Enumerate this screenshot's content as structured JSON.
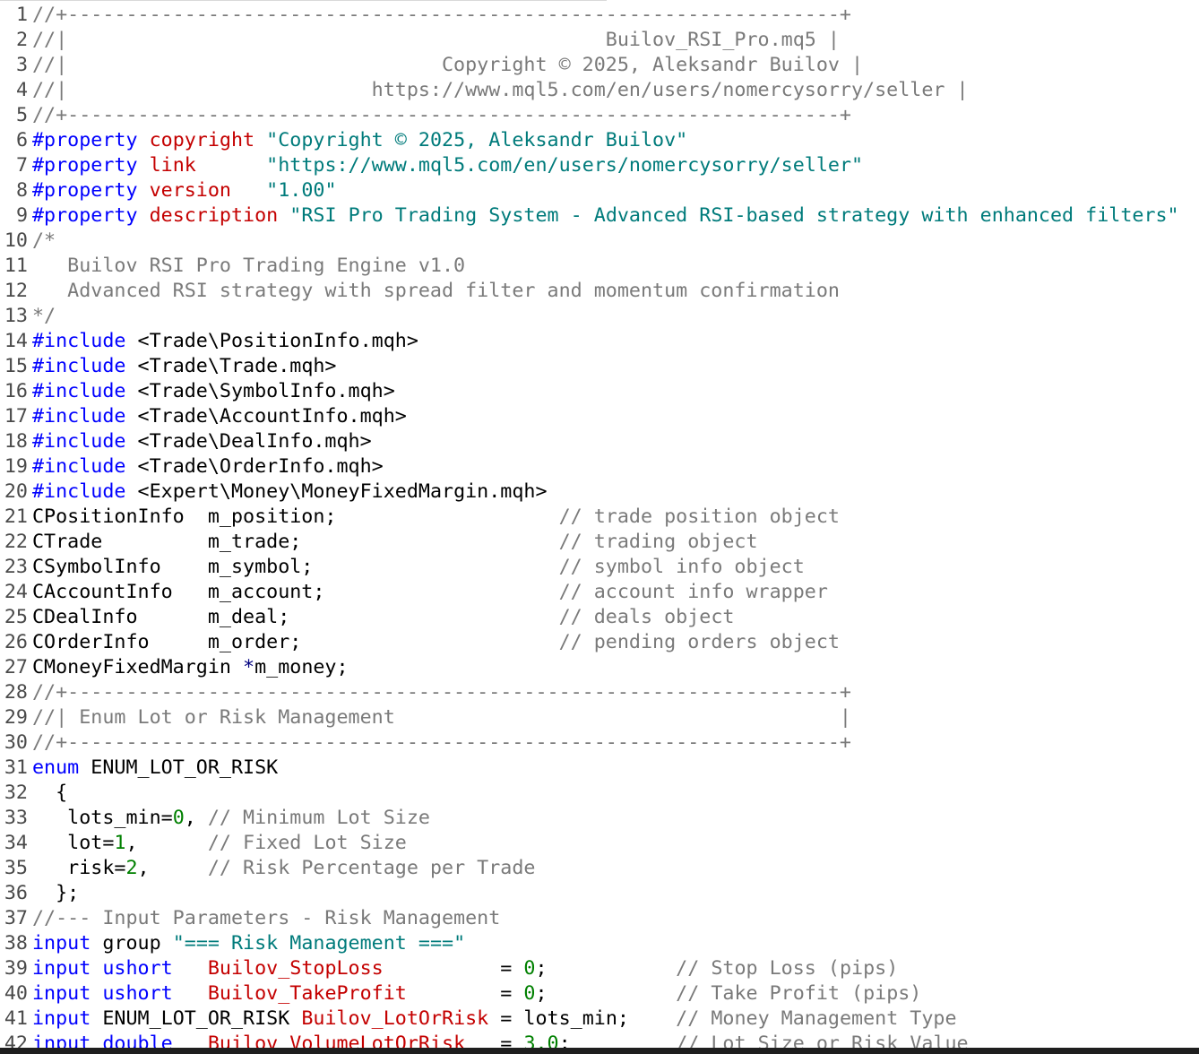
{
  "editor": {
    "file": "Builov_RSI_Pro.mq5",
    "colors": {
      "background": "#ffffff",
      "comment": "#7a7a7a",
      "keyword": "#0000ff",
      "property": "#c40000",
      "string": "#007b7b",
      "number": "#008000",
      "plain": "#000000",
      "line_number": "#4a4a4a"
    },
    "lines": [
      {
        "n": "1",
        "tokens": [
          {
            "t": "cmt",
            "v": "//+------------------------------------------------------------------+"
          }
        ]
      },
      {
        "n": "2",
        "tokens": [
          {
            "t": "cmt",
            "v": "//|                                              Builov_RSI_Pro.mq5 |"
          }
        ]
      },
      {
        "n": "3",
        "tokens": [
          {
            "t": "cmt",
            "v": "//|                                Copyright © 2025, Aleksandr Builov |"
          }
        ]
      },
      {
        "n": "4",
        "tokens": [
          {
            "t": "cmt",
            "v": "//|                          https://www.mql5.com/en/users/nomercysorry/seller |"
          }
        ]
      },
      {
        "n": "5",
        "tokens": [
          {
            "t": "cmt",
            "v": "//+------------------------------------------------------------------+"
          }
        ]
      },
      {
        "n": "6",
        "tokens": [
          {
            "t": "kw",
            "v": "#property"
          },
          {
            "t": "pln",
            "v": " "
          },
          {
            "t": "prop",
            "v": "copyright"
          },
          {
            "t": "pln",
            "v": " "
          },
          {
            "t": "str",
            "v": "\"Copyright © 2025, Aleksandr Builov\""
          }
        ]
      },
      {
        "n": "7",
        "tokens": [
          {
            "t": "kw",
            "v": "#property"
          },
          {
            "t": "pln",
            "v": " "
          },
          {
            "t": "prop",
            "v": "link"
          },
          {
            "t": "pln",
            "v": "      "
          },
          {
            "t": "str",
            "v": "\"https://www.mql5.com/en/users/nomercysorry/seller\""
          }
        ]
      },
      {
        "n": "8",
        "tokens": [
          {
            "t": "kw",
            "v": "#property"
          },
          {
            "t": "pln",
            "v": " "
          },
          {
            "t": "prop",
            "v": "version"
          },
          {
            "t": "pln",
            "v": "   "
          },
          {
            "t": "str",
            "v": "\"1.00\""
          }
        ]
      },
      {
        "n": "9",
        "tokens": [
          {
            "t": "kw",
            "v": "#property"
          },
          {
            "t": "pln",
            "v": " "
          },
          {
            "t": "prop",
            "v": "description"
          },
          {
            "t": "pln",
            "v": " "
          },
          {
            "t": "str",
            "v": "\"RSI Pro Trading System - Advanced RSI-based strategy with enhanced filters\""
          }
        ]
      },
      {
        "n": "10",
        "tokens": [
          {
            "t": "cmt",
            "v": "/*"
          }
        ]
      },
      {
        "n": "11",
        "tokens": [
          {
            "t": "cmt",
            "v": "   Builov RSI Pro Trading Engine v1.0"
          }
        ]
      },
      {
        "n": "12",
        "tokens": [
          {
            "t": "cmt",
            "v": "   Advanced RSI strategy with spread filter and momentum confirmation"
          }
        ]
      },
      {
        "n": "13",
        "tokens": [
          {
            "t": "cmt",
            "v": "*/"
          }
        ]
      },
      {
        "n": "14",
        "tokens": [
          {
            "t": "kw",
            "v": "#include"
          },
          {
            "t": "pln",
            "v": " <Trade\\PositionInfo.mqh>"
          }
        ]
      },
      {
        "n": "15",
        "tokens": [
          {
            "t": "kw",
            "v": "#include"
          },
          {
            "t": "pln",
            "v": " <Trade\\Trade.mqh>"
          }
        ]
      },
      {
        "n": "16",
        "tokens": [
          {
            "t": "kw",
            "v": "#include"
          },
          {
            "t": "pln",
            "v": " <Trade\\SymbolInfo.mqh>"
          }
        ]
      },
      {
        "n": "17",
        "tokens": [
          {
            "t": "kw",
            "v": "#include"
          },
          {
            "t": "pln",
            "v": " <Trade\\AccountInfo.mqh>"
          }
        ]
      },
      {
        "n": "18",
        "tokens": [
          {
            "t": "kw",
            "v": "#include"
          },
          {
            "t": "pln",
            "v": " <Trade\\DealInfo.mqh>"
          }
        ]
      },
      {
        "n": "19",
        "tokens": [
          {
            "t": "kw",
            "v": "#include"
          },
          {
            "t": "pln",
            "v": " <Trade\\OrderInfo.mqh>"
          }
        ]
      },
      {
        "n": "20",
        "tokens": [
          {
            "t": "kw",
            "v": "#include"
          },
          {
            "t": "pln",
            "v": " <Expert\\Money\\MoneyFixedMargin.mqh>"
          }
        ]
      },
      {
        "n": "21",
        "tokens": [
          {
            "t": "pln",
            "v": "CPositionInfo  m_position;                   "
          },
          {
            "t": "cmt",
            "v": "// trade position object"
          }
        ]
      },
      {
        "n": "22",
        "tokens": [
          {
            "t": "pln",
            "v": "CTrade         m_trade;                      "
          },
          {
            "t": "cmt",
            "v": "// trading object"
          }
        ]
      },
      {
        "n": "23",
        "tokens": [
          {
            "t": "pln",
            "v": "CSymbolInfo    m_symbol;                     "
          },
          {
            "t": "cmt",
            "v": "// symbol info object"
          }
        ]
      },
      {
        "n": "24",
        "tokens": [
          {
            "t": "pln",
            "v": "CAccountInfo   m_account;                    "
          },
          {
            "t": "cmt",
            "v": "// account info wrapper"
          }
        ]
      },
      {
        "n": "25",
        "tokens": [
          {
            "t": "pln",
            "v": "CDealInfo      m_deal;                       "
          },
          {
            "t": "cmt",
            "v": "// deals object"
          }
        ]
      },
      {
        "n": "26",
        "tokens": [
          {
            "t": "pln",
            "v": "COrderInfo     m_order;                      "
          },
          {
            "t": "cmt",
            "v": "// pending orders object"
          }
        ]
      },
      {
        "n": "27",
        "tokens": [
          {
            "t": "pln",
            "v": "CMoneyFixedMargin "
          },
          {
            "t": "ptr",
            "v": "*"
          },
          {
            "t": "pln",
            "v": "m_money;"
          }
        ]
      },
      {
        "n": "28",
        "tokens": [
          {
            "t": "cmt",
            "v": "//+------------------------------------------------------------------+"
          }
        ]
      },
      {
        "n": "29",
        "tokens": [
          {
            "t": "cmt",
            "v": "//| Enum Lot or Risk Management                                      |"
          }
        ]
      },
      {
        "n": "30",
        "tokens": [
          {
            "t": "cmt",
            "v": "//+------------------------------------------------------------------+"
          }
        ]
      },
      {
        "n": "31",
        "tokens": [
          {
            "t": "kw",
            "v": "enum"
          },
          {
            "t": "pln",
            "v": " ENUM_LOT_OR_RISK"
          }
        ]
      },
      {
        "n": "32",
        "tokens": [
          {
            "t": "pln",
            "v": "  {"
          }
        ]
      },
      {
        "n": "33",
        "tokens": [
          {
            "t": "pln",
            "v": "   lots_min="
          },
          {
            "t": "num",
            "v": "0"
          },
          {
            "t": "pln",
            "v": ", "
          },
          {
            "t": "cmt",
            "v": "// Minimum Lot Size"
          }
        ]
      },
      {
        "n": "34",
        "tokens": [
          {
            "t": "pln",
            "v": "   lot="
          },
          {
            "t": "num",
            "v": "1"
          },
          {
            "t": "pln",
            "v": ",      "
          },
          {
            "t": "cmt",
            "v": "// Fixed Lot Size"
          }
        ]
      },
      {
        "n": "35",
        "tokens": [
          {
            "t": "pln",
            "v": "   risk="
          },
          {
            "t": "num",
            "v": "2"
          },
          {
            "t": "pln",
            "v": ",     "
          },
          {
            "t": "cmt",
            "v": "// Risk Percentage per Trade"
          }
        ]
      },
      {
        "n": "36",
        "tokens": [
          {
            "t": "pln",
            "v": "  };"
          }
        ]
      },
      {
        "n": "37",
        "tokens": [
          {
            "t": "cmt",
            "v": "//--- Input Parameters - Risk Management"
          }
        ]
      },
      {
        "n": "38",
        "tokens": [
          {
            "t": "kw",
            "v": "input"
          },
          {
            "t": "pln",
            "v": " group "
          },
          {
            "t": "str",
            "v": "\"=== Risk Management ===\""
          }
        ]
      },
      {
        "n": "39",
        "tokens": [
          {
            "t": "kw",
            "v": "input"
          },
          {
            "t": "pln",
            "v": " "
          },
          {
            "t": "kw",
            "v": "ushort"
          },
          {
            "t": "pln",
            "v": "   "
          },
          {
            "t": "prop",
            "v": "Builov_StopLoss"
          },
          {
            "t": "pln",
            "v": "          = "
          },
          {
            "t": "num",
            "v": "0"
          },
          {
            "t": "pln",
            "v": ";           "
          },
          {
            "t": "cmt",
            "v": "// Stop Loss (pips)"
          }
        ]
      },
      {
        "n": "40",
        "tokens": [
          {
            "t": "kw",
            "v": "input"
          },
          {
            "t": "pln",
            "v": " "
          },
          {
            "t": "kw",
            "v": "ushort"
          },
          {
            "t": "pln",
            "v": "   "
          },
          {
            "t": "prop",
            "v": "Builov_TakeProfit"
          },
          {
            "t": "pln",
            "v": "        = "
          },
          {
            "t": "num",
            "v": "0"
          },
          {
            "t": "pln",
            "v": ";           "
          },
          {
            "t": "cmt",
            "v": "// Take Profit (pips)"
          }
        ]
      },
      {
        "n": "41",
        "tokens": [
          {
            "t": "kw",
            "v": "input"
          },
          {
            "t": "pln",
            "v": " ENUM_LOT_OR_RISK "
          },
          {
            "t": "prop",
            "v": "Builov_LotOrRisk"
          },
          {
            "t": "pln",
            "v": " = lots_min;    "
          },
          {
            "t": "cmt",
            "v": "// Money Management Type"
          }
        ]
      },
      {
        "n": "42",
        "tokens": [
          {
            "t": "kw",
            "v": "input"
          },
          {
            "t": "pln",
            "v": " "
          },
          {
            "t": "kw",
            "v": "double"
          },
          {
            "t": "pln",
            "v": "   "
          },
          {
            "t": "prop",
            "v": "Builov_VolumeLotOrRisk"
          },
          {
            "t": "pln",
            "v": "   = "
          },
          {
            "t": "num",
            "v": "3.0"
          },
          {
            "t": "pln",
            "v": ";         "
          },
          {
            "t": "cmt",
            "v": "// Lot Size or Risk Value"
          }
        ]
      }
    ]
  }
}
